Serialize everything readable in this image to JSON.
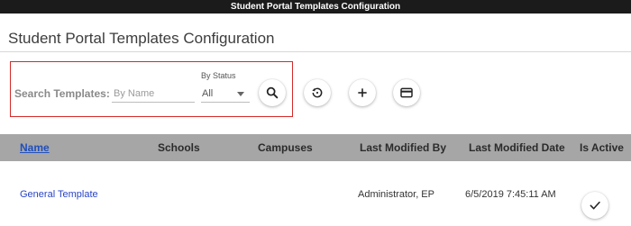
{
  "window": {
    "title": "Student Portal Templates Configuration"
  },
  "page": {
    "title": "Student Portal Templates Configuration"
  },
  "search": {
    "label": "Search Templates:",
    "name_placeholder": "By Name",
    "name_value": "",
    "status_caption": "By Status",
    "status_value": "All"
  },
  "actions": {
    "search_icon": "search-icon",
    "reset_icon": "history-icon",
    "add_icon": "plus-icon",
    "card_icon": "credit-card-icon"
  },
  "table": {
    "headers": {
      "name": "Name",
      "schools": "Schools",
      "campuses": "Campuses",
      "last_modified_by": "Last Modified By",
      "last_modified_date": "Last Modified Date",
      "is_active": "Is Active"
    },
    "rows": [
      {
        "name": "General Template",
        "schools": "",
        "campuses": "",
        "last_modified_by": "Administrator, EP",
        "last_modified_date": "6/5/2019 7:45:11 AM",
        "is_active_icon": "check-icon"
      }
    ]
  },
  "colors": {
    "titlebar": "#1b1b1b",
    "highlight_border": "#d42a2a",
    "table_header": "#a6a6a6",
    "link": "#2944c7"
  }
}
